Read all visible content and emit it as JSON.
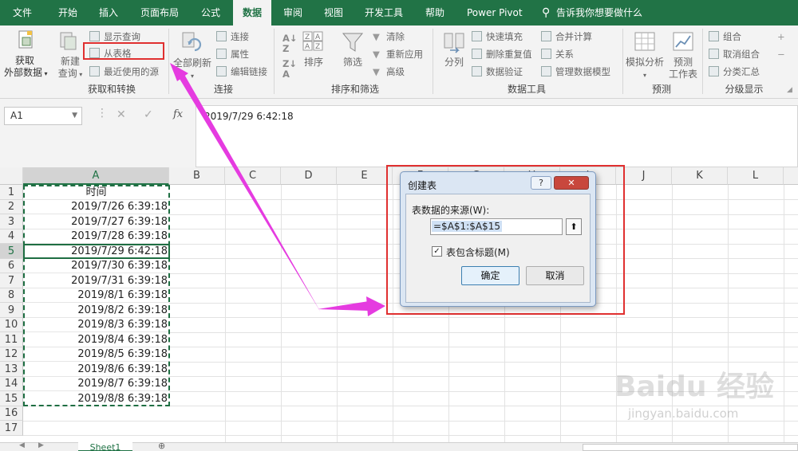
{
  "ribbon_tabs": [
    "文件",
    "开始",
    "插入",
    "页面布局",
    "公式",
    "数据",
    "审阅",
    "视图",
    "开发工具",
    "帮助",
    "Power Pivot",
    "告诉我你想要做什么"
  ],
  "active_tab": "数据",
  "groups": {
    "get_transform": {
      "label": "获取和转换",
      "get_data_line1": "获取",
      "get_data_line2": "外部数据",
      "new_query_line1": "新建",
      "new_query_line2": "查询",
      "show_queries": "显示查询",
      "from_table": "从表格",
      "recent_sources": "最近使用的源"
    },
    "connections": {
      "label": "连接",
      "refresh_all": "全部刷新",
      "connections": "连接",
      "properties": "属性",
      "edit_links": "编辑链接"
    },
    "sort_filter": {
      "label": "排序和筛选",
      "sort": "排序",
      "filter": "筛选",
      "clear": "清除",
      "reapply": "重新应用",
      "advanced": "高级"
    },
    "data_tools": {
      "label": "数据工具",
      "text_to_columns": "分列",
      "flash_fill": "快速填充",
      "remove_duplicates": "删除重复值",
      "data_validation": "数据验证",
      "consolidate": "合并计算",
      "relationships": "关系",
      "manage_model": "管理数据模型"
    },
    "forecast": {
      "label": "预测",
      "what_if": "模拟分析",
      "forecast_sheet_line1": "预测",
      "forecast_sheet_line2": "工作表"
    },
    "outline": {
      "label": "分级显示",
      "group": "组合",
      "ungroup": "取消组合",
      "subtotal": "分类汇总"
    }
  },
  "formula_bar": {
    "name_box": "A1",
    "fx": "fx",
    "cancel": "✕",
    "enter": "✓",
    "content": "2019/7/29  6:42:18"
  },
  "columns": [
    "A",
    "B",
    "C",
    "D",
    "E",
    "F",
    "G",
    "H",
    "I",
    "J",
    "K",
    "L"
  ],
  "rows": [
    "1",
    "2",
    "3",
    "4",
    "5",
    "6",
    "7",
    "8",
    "9",
    "10",
    "11",
    "12",
    "13",
    "14",
    "15",
    "16",
    "17"
  ],
  "cells": [
    "时间",
    "2019/7/26 6:39:18",
    "2019/7/27 6:39:18",
    "2019/7/28 6:39:18",
    "2019/7/29 6:42:18",
    "2019/7/30 6:39:18",
    "2019/7/31 6:39:18",
    "2019/8/1 6:39:18",
    "2019/8/2 6:39:18",
    "2019/8/3 6:39:18",
    "2019/8/4 6:39:18",
    "2019/8/5 6:39:18",
    "2019/8/6 6:39:18",
    "2019/8/7 6:39:18",
    "2019/8/8 6:39:18"
  ],
  "sheet_tab": "Sheet1",
  "dialog": {
    "title": "创建表",
    "help": "?",
    "close": "✕",
    "source_label": "表数据的来源(W):",
    "range_value": "=$A$1:$A$15",
    "has_headers_label": "表包含标题(M)",
    "has_headers_checked": true,
    "ok": "确定",
    "cancel": "取消"
  },
  "watermark": {
    "brand": "Baidu 经验",
    "url": "jingyan.baidu.com"
  },
  "colors": {
    "excel_green": "#217346",
    "highlight_red": "#e03030",
    "arrow_magenta": "#e53be0",
    "selection_green": "#1e6e42"
  }
}
